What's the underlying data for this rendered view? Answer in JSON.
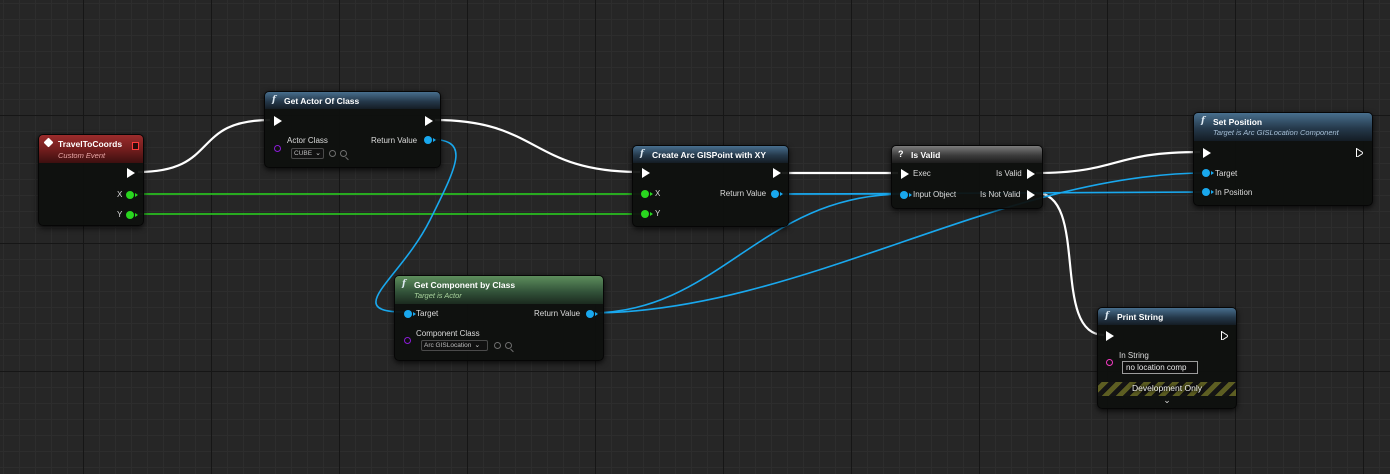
{
  "nodes": {
    "travel_to_coords": {
      "title": "TravelToCoords",
      "subtitle": "Custom Event",
      "pins": {
        "x": "X",
        "y": "Y"
      }
    },
    "get_actor_of_class": {
      "title": "Get Actor Of Class",
      "pins": {
        "actor_class": "Actor Class",
        "return_value": "Return Value"
      },
      "actor_class_value": "CUBE"
    },
    "create_arc_gis_point": {
      "title": "Create Arc GISPoint with XY",
      "pins": {
        "x": "X",
        "y": "Y",
        "return_value": "Return Value"
      }
    },
    "is_valid": {
      "title": "Is Valid",
      "pins": {
        "exec": "Exec",
        "input_object": "Input Object",
        "is_valid": "Is Valid",
        "is_not_valid": "Is Not Valid"
      }
    },
    "set_position": {
      "title": "Set Position",
      "subtitle": "Target is Arc GISLocation Component",
      "pins": {
        "target": "Target",
        "in_position": "In Position"
      }
    },
    "get_component_by_class": {
      "title": "Get Component by Class",
      "subtitle": "Target is Actor",
      "pins": {
        "target": "Target",
        "component_class": "Component Class",
        "return_value": "Return Value"
      },
      "component_class_value": "Arc GISLocation"
    },
    "print_string": {
      "title": "Print String",
      "pins": {
        "in_string": "In String"
      },
      "in_string_value": "no location comp",
      "dev_only_label": "Development Only",
      "expand_icon": "chevron-down-icon"
    }
  },
  "colors": {
    "exec_wire": "#ffffff",
    "float_wire": "#29d61f",
    "object_wire": "#19a8ee",
    "class_pin": "#8a1bd6",
    "string_pin": "#f43bc2",
    "function_header": "#35546e",
    "event_header": "#7a1f1f",
    "pure_header": "#4d7a4c"
  }
}
